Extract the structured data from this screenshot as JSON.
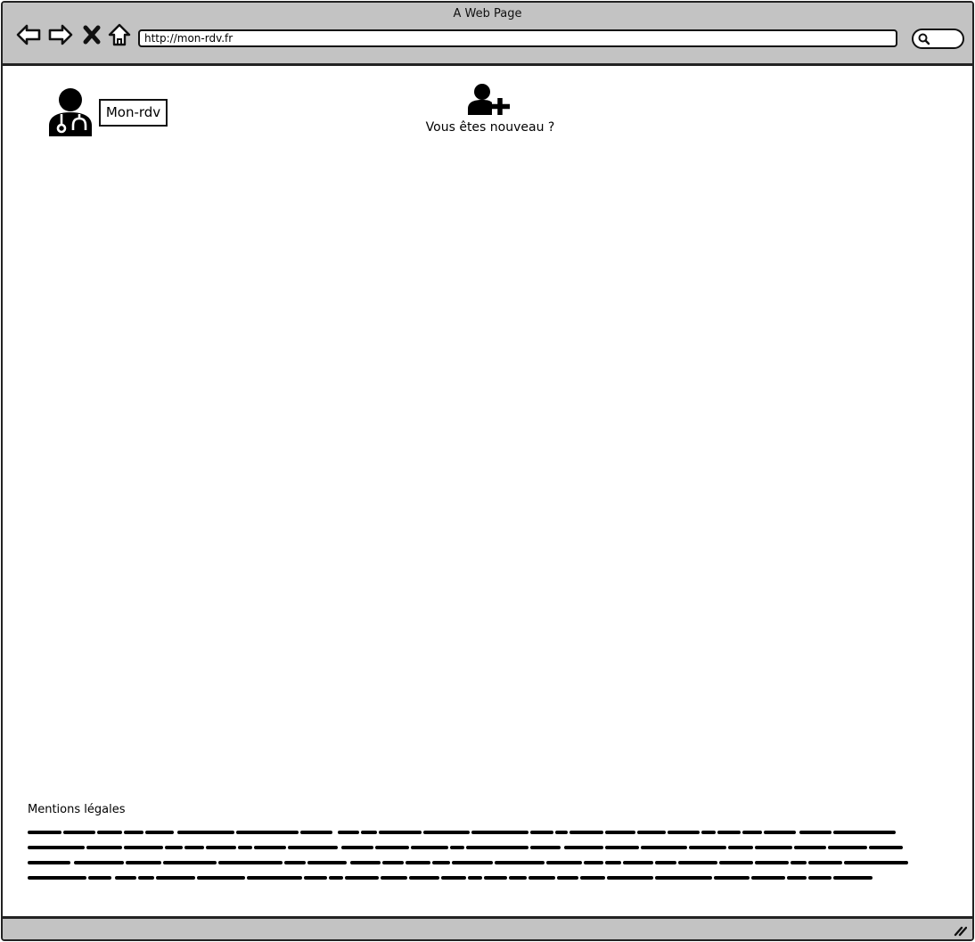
{
  "browser": {
    "window_title": "A Web Page",
    "url": "http://mon-rdv.fr",
    "icons": [
      "back-arrow-icon",
      "forward-arrow-icon",
      "stop-icon",
      "home-icon",
      "search-icon",
      "resize-grip-icon"
    ]
  },
  "header": {
    "logo_icon": "doctor-icon",
    "logo_label": "Mon-rdv",
    "signup_icon": "add-user-icon",
    "signup_text": "Vous êtes nouveau ?"
  },
  "footer": {
    "title": "Mentions légales"
  }
}
